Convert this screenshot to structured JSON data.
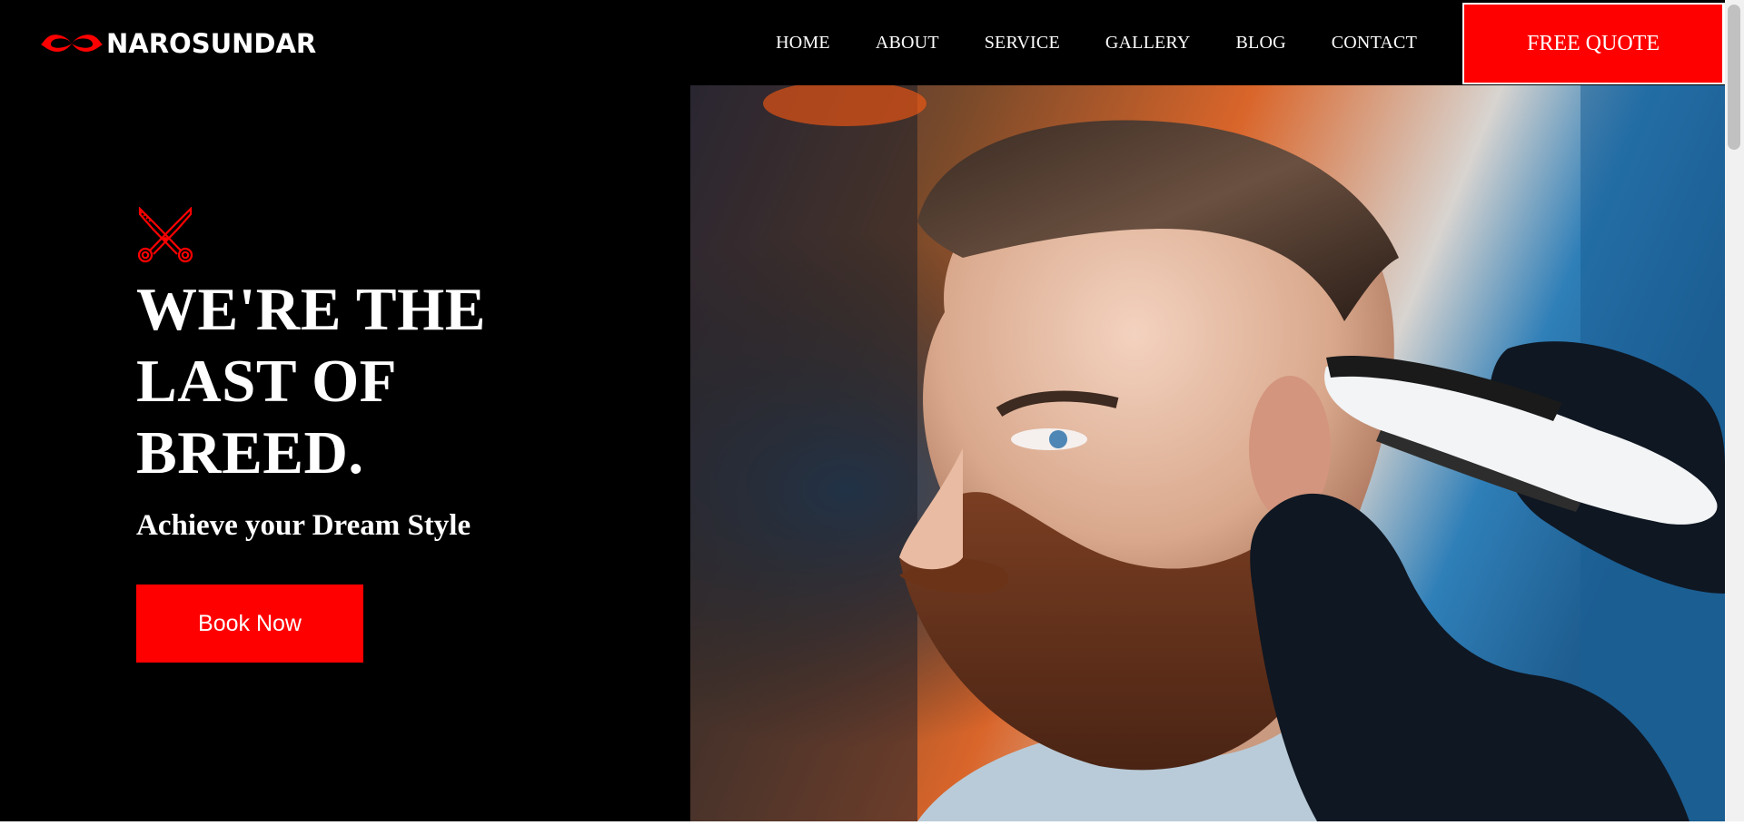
{
  "brand": {
    "name": "NAROSUNDAR",
    "accent": "#ff0000",
    "logo_icon": "mustache-icon"
  },
  "nav": {
    "items": [
      {
        "label": "HOME"
      },
      {
        "label": "ABOUT"
      },
      {
        "label": "SERVICE"
      },
      {
        "label": "GALLERY"
      },
      {
        "label": "BLOG"
      },
      {
        "label": "CONTACT"
      }
    ],
    "cta_label": "FREE QUOTE"
  },
  "hero": {
    "icon": "scissors-icon",
    "headline_lines": [
      "WE'RE THE",
      "LAST OF",
      "BREED."
    ],
    "subheadline": "Achieve your Dream Style",
    "button_label": "Book Now",
    "image": "barber-trimming-bearded-man-photo"
  }
}
